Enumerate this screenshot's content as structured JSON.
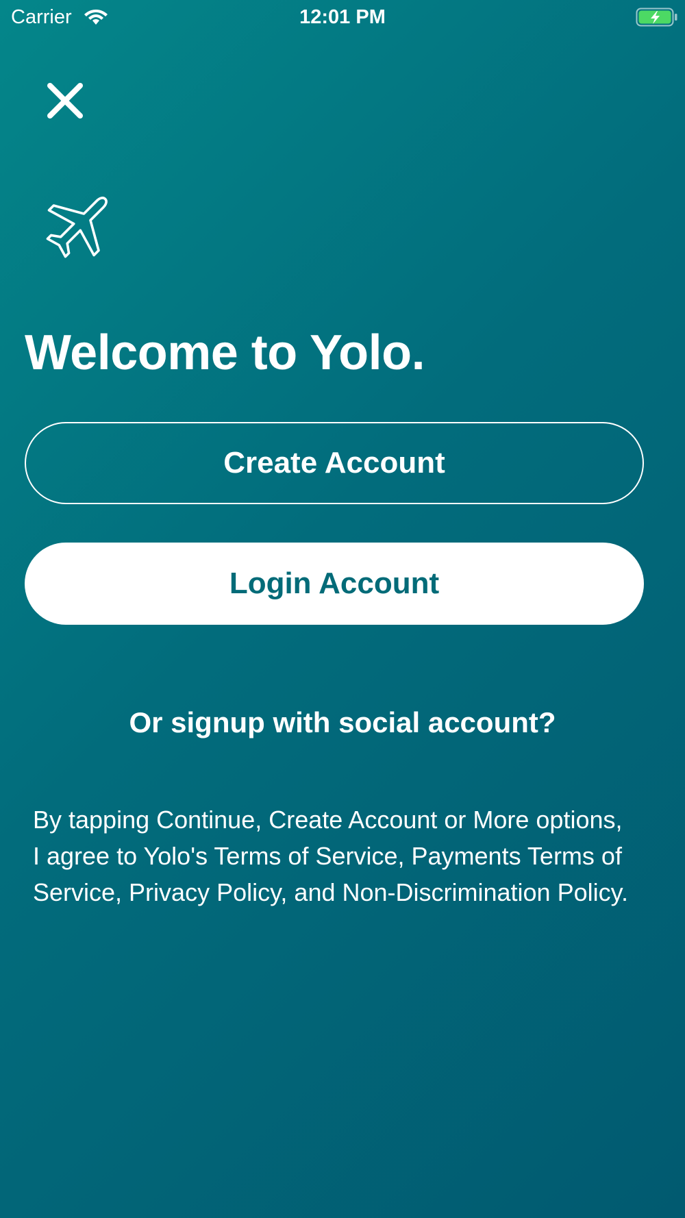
{
  "status_bar": {
    "carrier": "Carrier",
    "time": "12:01 PM",
    "wifi_icon": "wifi-icon",
    "battery_icon": "battery-charging-icon",
    "battery_color": "#4cd964"
  },
  "header": {
    "close_icon": "close-icon",
    "logo_icon": "airplane-icon"
  },
  "main": {
    "title": "Welcome to Yolo.",
    "create_account_label": "Create Account",
    "login_account_label": "Login Account",
    "social_link": "Or signup with social account?",
    "legal_text": "By tapping Continue, Create Account or More options, I agree to Yolo's Terms of Service, Payments Terms of Service, Privacy Policy, and Non-Discrimination Policy."
  },
  "colors": {
    "background_start": "#04868a",
    "background_end": "#015a70",
    "accent": "#036b78",
    "text": "#ffffff"
  }
}
